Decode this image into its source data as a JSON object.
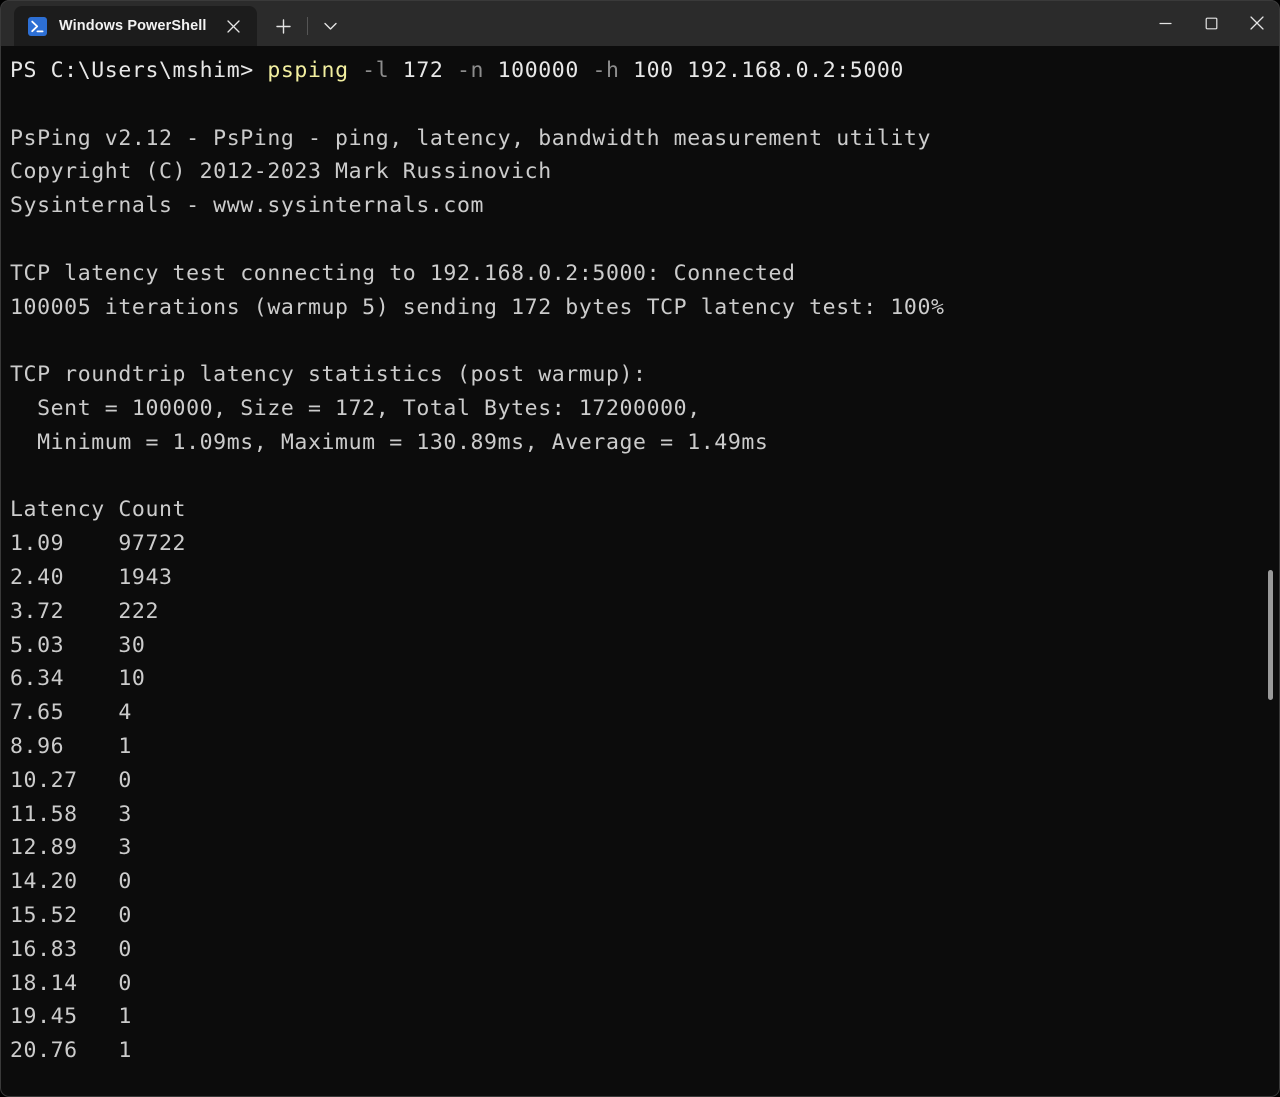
{
  "window": {
    "titlebar_color": "#2b2b2b",
    "tab_color": "#1c1c1c",
    "terminal_bg": "#0c0c0c",
    "tab": {
      "title": "Windows PowerShell",
      "icon": "powershell-icon",
      "close_icon": "close-icon"
    },
    "new_tab_icon": "plus-icon",
    "dropdown_icon": "chevron-down-icon",
    "controls": {
      "minimize": "minimize-icon",
      "maximize": "maximize-icon",
      "close": "close-icon"
    }
  },
  "terminal": {
    "prompt": "PS C:\\Users\\mshim> ",
    "command": {
      "name": "psping",
      "args": [
        {
          "text": " ",
          "style": "plain"
        },
        {
          "text": "-l",
          "style": "dim"
        },
        {
          "text": " 172 ",
          "style": "white"
        },
        {
          "text": "-n",
          "style": "dim"
        },
        {
          "text": " 100000 ",
          "style": "white"
        },
        {
          "text": "-h",
          "style": "dim"
        },
        {
          "text": " 100 192.168.0.2:5000",
          "style": "white"
        }
      ],
      "full_text": "psping -l 172 -n 100000 -h 100 192.168.0.2:5000"
    },
    "banner": [
      "PsPing v2.12 - PsPing - ping, latency, bandwidth measurement utility",
      "Copyright (C) 2012-2023 Mark Russinovich",
      "Sysinternals - www.sysinternals.com"
    ],
    "connection": [
      "TCP latency test connecting to 192.168.0.2:5000: Connected",
      "100005 iterations (warmup 5) sending 172 bytes TCP latency test: 100%"
    ],
    "stats": {
      "heading": "TCP roundtrip latency statistics (post warmup):",
      "lines": [
        "  Sent = 100000, Size = 172, Total Bytes: 17200000,",
        "  Minimum = 1.09ms, Maximum = 130.89ms, Average = 1.49ms"
      ],
      "sent": "100000",
      "size": "172",
      "total_bytes": "17200000",
      "minimum": "1.09ms",
      "maximum": "130.89ms",
      "average": "1.49ms"
    },
    "histogram": {
      "headers": [
        "Latency",
        "Count"
      ],
      "header_line": "Latency Count",
      "rows": [
        {
          "latency": "1.09",
          "count": "97722"
        },
        {
          "latency": "2.40",
          "count": "1943"
        },
        {
          "latency": "3.72",
          "count": "222"
        },
        {
          "latency": "5.03",
          "count": "30"
        },
        {
          "latency": "6.34",
          "count": "10"
        },
        {
          "latency": "7.65",
          "count": "4"
        },
        {
          "latency": "8.96",
          "count": "1"
        },
        {
          "latency": "10.27",
          "count": "0"
        },
        {
          "latency": "11.58",
          "count": "3"
        },
        {
          "latency": "12.89",
          "count": "3"
        },
        {
          "latency": "14.20",
          "count": "0"
        },
        {
          "latency": "15.52",
          "count": "0"
        },
        {
          "latency": "16.83",
          "count": "0"
        },
        {
          "latency": "18.14",
          "count": "0"
        },
        {
          "latency": "19.45",
          "count": "1"
        },
        {
          "latency": "20.76",
          "count": "1"
        }
      ]
    }
  }
}
